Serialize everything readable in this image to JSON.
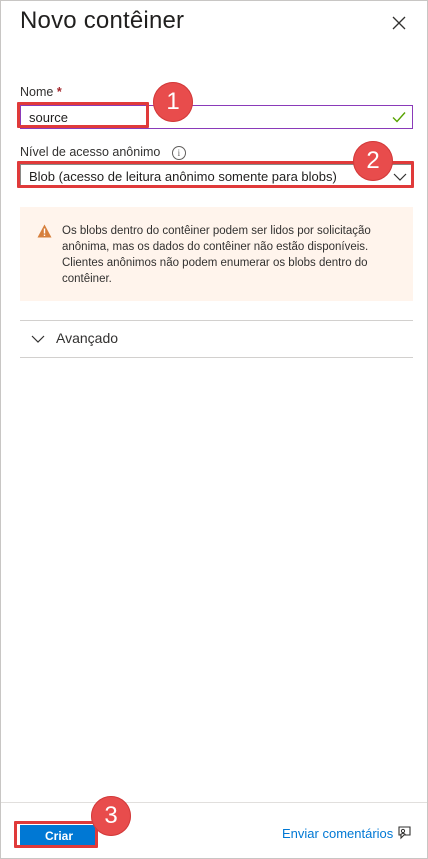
{
  "panel": {
    "title": "Novo contêiner"
  },
  "name_field": {
    "label": "Nome",
    "required_mark": "*",
    "value": "source"
  },
  "access_level": {
    "label": "Nível de acesso anônimo",
    "info_glyph": "i",
    "selected": "Blob (acesso de leitura anônimo somente para blobs)"
  },
  "warning": {
    "text": "Os blobs dentro do contêiner podem ser lidos por solicitação anônima, mas os dados do contêiner não estão disponíveis. Clientes anônimos não podem enumerar os blobs dentro do contêiner.",
    "color": "#d67f3c"
  },
  "advanced": {
    "label": "Avançado"
  },
  "footer": {
    "create_label": "Criar",
    "feedback_label": "Enviar comentários"
  },
  "annotations": {
    "badge_1": "1",
    "badge_2": "2",
    "badge_3": "3",
    "color": "#e03a3a"
  },
  "colors": {
    "accent": "#0078d4",
    "valid_check": "#57a300",
    "input_focus_border": "#8a3ab9"
  }
}
